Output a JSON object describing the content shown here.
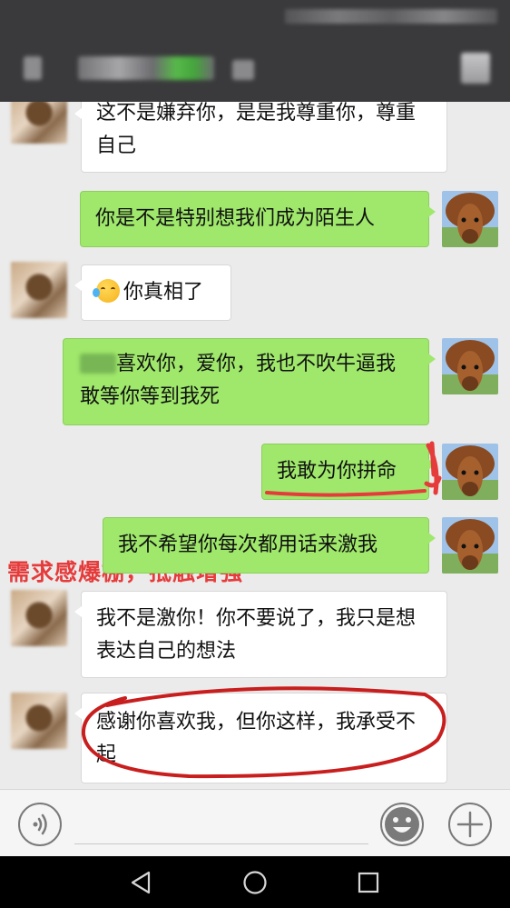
{
  "messages": [
    {
      "side": "left",
      "text": "这不是嫌弃你，是是我尊重你，尊重自己"
    },
    {
      "side": "right",
      "text": "你是不是特别想我们成为陌生人"
    },
    {
      "side": "left",
      "text": "你真相了",
      "emoji": "face-with-tears-of-joy-icon"
    },
    {
      "side": "right",
      "text": "喜欢你，爱你，我也不吹牛逼我敢等你等到我死"
    },
    {
      "side": "right",
      "text": "我敢为你拼命"
    },
    {
      "side": "right",
      "text": "我不希望你每次都用话来激我"
    },
    {
      "side": "left",
      "text": "我不是激你！你不要说了，我只是想表达自己的想法"
    },
    {
      "side": "left",
      "text": "感谢你喜欢我，但你这样，我承受不起"
    }
  ],
  "annotation": {
    "text": "需求感爆棚，抵触增强",
    "color": "#e63b3b"
  },
  "input_bar": {
    "voice_icon": "voice-icon",
    "emoji_icon": "emoji-icon",
    "plus_icon": "plus-icon"
  },
  "nav_bar": {
    "back_icon": "back-triangle-icon",
    "home_icon": "home-circle-icon",
    "recents_icon": "recents-square-icon"
  },
  "colors": {
    "header": "#3a3a3c",
    "chat_bg": "#ebebeb",
    "green_bubble": "#9fe86b",
    "white_bubble": "#ffffff",
    "highlight": "#e63b3b"
  }
}
